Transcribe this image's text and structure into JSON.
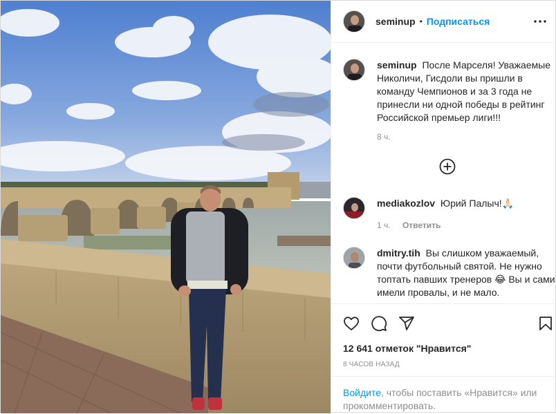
{
  "post": {
    "author": "seminup",
    "dot": "•",
    "follow_label": "Подписаться",
    "caption_user": "seminup",
    "caption_text": "После Марселя! Уважаемые Николичи, Гисдоли вы пришли в команду Чемпионов и за 3 года не принесли ни одной победы в рейтинг Российской премьер лиги!!!",
    "caption_time": "8 ч."
  },
  "comments": [
    {
      "user": "mediakozlov",
      "text": "Юрий Палыч!🙏🏻",
      "time": "1 ч.",
      "reply_label": "Ответить"
    },
    {
      "user": "dmitry.tih",
      "text": "Вы слишком уважаемый, почти футбольный святой. Не нужно топтать павших тренеров 😂 Вы и сами имели провалы, и не мало."
    }
  ],
  "actions": {
    "likes": "12 641 отметок \"Нравится\"",
    "time_ago": "8 ЧАСОВ НАЗАД"
  },
  "login": {
    "link_label": "Войдите",
    "rest": ", чтобы поставить «Нравится» или прокомментировать."
  },
  "icons": [
    "more-options-icon",
    "load-more-comments-icon",
    "like-icon",
    "comment-icon",
    "share-icon",
    "save-icon"
  ],
  "colors": {
    "link": "#0095f6",
    "secondary": "#8e8e8e",
    "text": "#262626",
    "border": "#efefef"
  }
}
